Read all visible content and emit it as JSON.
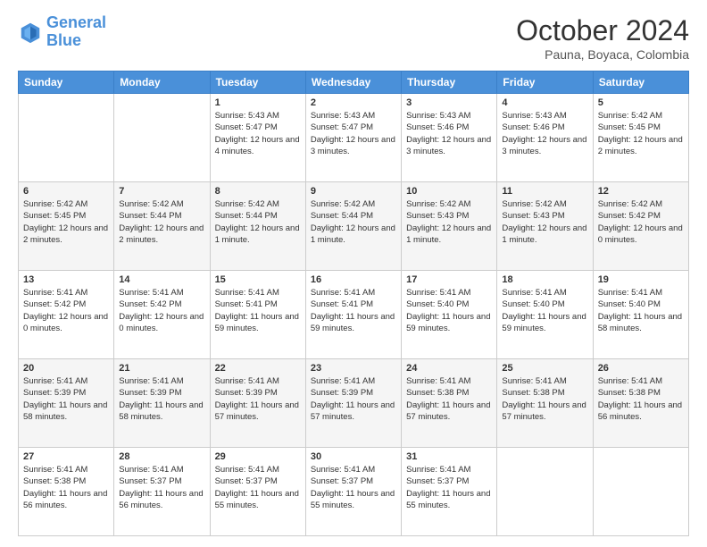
{
  "header": {
    "logo_text_general": "General",
    "logo_text_blue": "Blue",
    "month_title": "October 2024",
    "location": "Pauna, Boyaca, Colombia"
  },
  "weekdays": [
    "Sunday",
    "Monday",
    "Tuesday",
    "Wednesday",
    "Thursday",
    "Friday",
    "Saturday"
  ],
  "weeks": [
    [
      {
        "day": "",
        "sunrise": "",
        "sunset": "",
        "daylight": "",
        "empty": true
      },
      {
        "day": "",
        "sunrise": "",
        "sunset": "",
        "daylight": "",
        "empty": true
      },
      {
        "day": "1",
        "sunrise": "Sunrise: 5:43 AM",
        "sunset": "Sunset: 5:47 PM",
        "daylight": "Daylight: 12 hours and 4 minutes."
      },
      {
        "day": "2",
        "sunrise": "Sunrise: 5:43 AM",
        "sunset": "Sunset: 5:47 PM",
        "daylight": "Daylight: 12 hours and 3 minutes."
      },
      {
        "day": "3",
        "sunrise": "Sunrise: 5:43 AM",
        "sunset": "Sunset: 5:46 PM",
        "daylight": "Daylight: 12 hours and 3 minutes."
      },
      {
        "day": "4",
        "sunrise": "Sunrise: 5:43 AM",
        "sunset": "Sunset: 5:46 PM",
        "daylight": "Daylight: 12 hours and 3 minutes."
      },
      {
        "day": "5",
        "sunrise": "Sunrise: 5:42 AM",
        "sunset": "Sunset: 5:45 PM",
        "daylight": "Daylight: 12 hours and 2 minutes."
      }
    ],
    [
      {
        "day": "6",
        "sunrise": "Sunrise: 5:42 AM",
        "sunset": "Sunset: 5:45 PM",
        "daylight": "Daylight: 12 hours and 2 minutes."
      },
      {
        "day": "7",
        "sunrise": "Sunrise: 5:42 AM",
        "sunset": "Sunset: 5:44 PM",
        "daylight": "Daylight: 12 hours and 2 minutes."
      },
      {
        "day": "8",
        "sunrise": "Sunrise: 5:42 AM",
        "sunset": "Sunset: 5:44 PM",
        "daylight": "Daylight: 12 hours and 1 minute."
      },
      {
        "day": "9",
        "sunrise": "Sunrise: 5:42 AM",
        "sunset": "Sunset: 5:44 PM",
        "daylight": "Daylight: 12 hours and 1 minute."
      },
      {
        "day": "10",
        "sunrise": "Sunrise: 5:42 AM",
        "sunset": "Sunset: 5:43 PM",
        "daylight": "Daylight: 12 hours and 1 minute."
      },
      {
        "day": "11",
        "sunrise": "Sunrise: 5:42 AM",
        "sunset": "Sunset: 5:43 PM",
        "daylight": "Daylight: 12 hours and 1 minute."
      },
      {
        "day": "12",
        "sunrise": "Sunrise: 5:42 AM",
        "sunset": "Sunset: 5:42 PM",
        "daylight": "Daylight: 12 hours and 0 minutes."
      }
    ],
    [
      {
        "day": "13",
        "sunrise": "Sunrise: 5:41 AM",
        "sunset": "Sunset: 5:42 PM",
        "daylight": "Daylight: 12 hours and 0 minutes."
      },
      {
        "day": "14",
        "sunrise": "Sunrise: 5:41 AM",
        "sunset": "Sunset: 5:42 PM",
        "daylight": "Daylight: 12 hours and 0 minutes."
      },
      {
        "day": "15",
        "sunrise": "Sunrise: 5:41 AM",
        "sunset": "Sunset: 5:41 PM",
        "daylight": "Daylight: 11 hours and 59 minutes."
      },
      {
        "day": "16",
        "sunrise": "Sunrise: 5:41 AM",
        "sunset": "Sunset: 5:41 PM",
        "daylight": "Daylight: 11 hours and 59 minutes."
      },
      {
        "day": "17",
        "sunrise": "Sunrise: 5:41 AM",
        "sunset": "Sunset: 5:40 PM",
        "daylight": "Daylight: 11 hours and 59 minutes."
      },
      {
        "day": "18",
        "sunrise": "Sunrise: 5:41 AM",
        "sunset": "Sunset: 5:40 PM",
        "daylight": "Daylight: 11 hours and 59 minutes."
      },
      {
        "day": "19",
        "sunrise": "Sunrise: 5:41 AM",
        "sunset": "Sunset: 5:40 PM",
        "daylight": "Daylight: 11 hours and 58 minutes."
      }
    ],
    [
      {
        "day": "20",
        "sunrise": "Sunrise: 5:41 AM",
        "sunset": "Sunset: 5:39 PM",
        "daylight": "Daylight: 11 hours and 58 minutes."
      },
      {
        "day": "21",
        "sunrise": "Sunrise: 5:41 AM",
        "sunset": "Sunset: 5:39 PM",
        "daylight": "Daylight: 11 hours and 58 minutes."
      },
      {
        "day": "22",
        "sunrise": "Sunrise: 5:41 AM",
        "sunset": "Sunset: 5:39 PM",
        "daylight": "Daylight: 11 hours and 57 minutes."
      },
      {
        "day": "23",
        "sunrise": "Sunrise: 5:41 AM",
        "sunset": "Sunset: 5:39 PM",
        "daylight": "Daylight: 11 hours and 57 minutes."
      },
      {
        "day": "24",
        "sunrise": "Sunrise: 5:41 AM",
        "sunset": "Sunset: 5:38 PM",
        "daylight": "Daylight: 11 hours and 57 minutes."
      },
      {
        "day": "25",
        "sunrise": "Sunrise: 5:41 AM",
        "sunset": "Sunset: 5:38 PM",
        "daylight": "Daylight: 11 hours and 57 minutes."
      },
      {
        "day": "26",
        "sunrise": "Sunrise: 5:41 AM",
        "sunset": "Sunset: 5:38 PM",
        "daylight": "Daylight: 11 hours and 56 minutes."
      }
    ],
    [
      {
        "day": "27",
        "sunrise": "Sunrise: 5:41 AM",
        "sunset": "Sunset: 5:38 PM",
        "daylight": "Daylight: 11 hours and 56 minutes."
      },
      {
        "day": "28",
        "sunrise": "Sunrise: 5:41 AM",
        "sunset": "Sunset: 5:37 PM",
        "daylight": "Daylight: 11 hours and 56 minutes."
      },
      {
        "day": "29",
        "sunrise": "Sunrise: 5:41 AM",
        "sunset": "Sunset: 5:37 PM",
        "daylight": "Daylight: 11 hours and 55 minutes."
      },
      {
        "day": "30",
        "sunrise": "Sunrise: 5:41 AM",
        "sunset": "Sunset: 5:37 PM",
        "daylight": "Daylight: 11 hours and 55 minutes."
      },
      {
        "day": "31",
        "sunrise": "Sunrise: 5:41 AM",
        "sunset": "Sunset: 5:37 PM",
        "daylight": "Daylight: 11 hours and 55 minutes."
      },
      {
        "day": "",
        "sunrise": "",
        "sunset": "",
        "daylight": "",
        "empty": true
      },
      {
        "day": "",
        "sunrise": "",
        "sunset": "",
        "daylight": "",
        "empty": true
      }
    ]
  ]
}
